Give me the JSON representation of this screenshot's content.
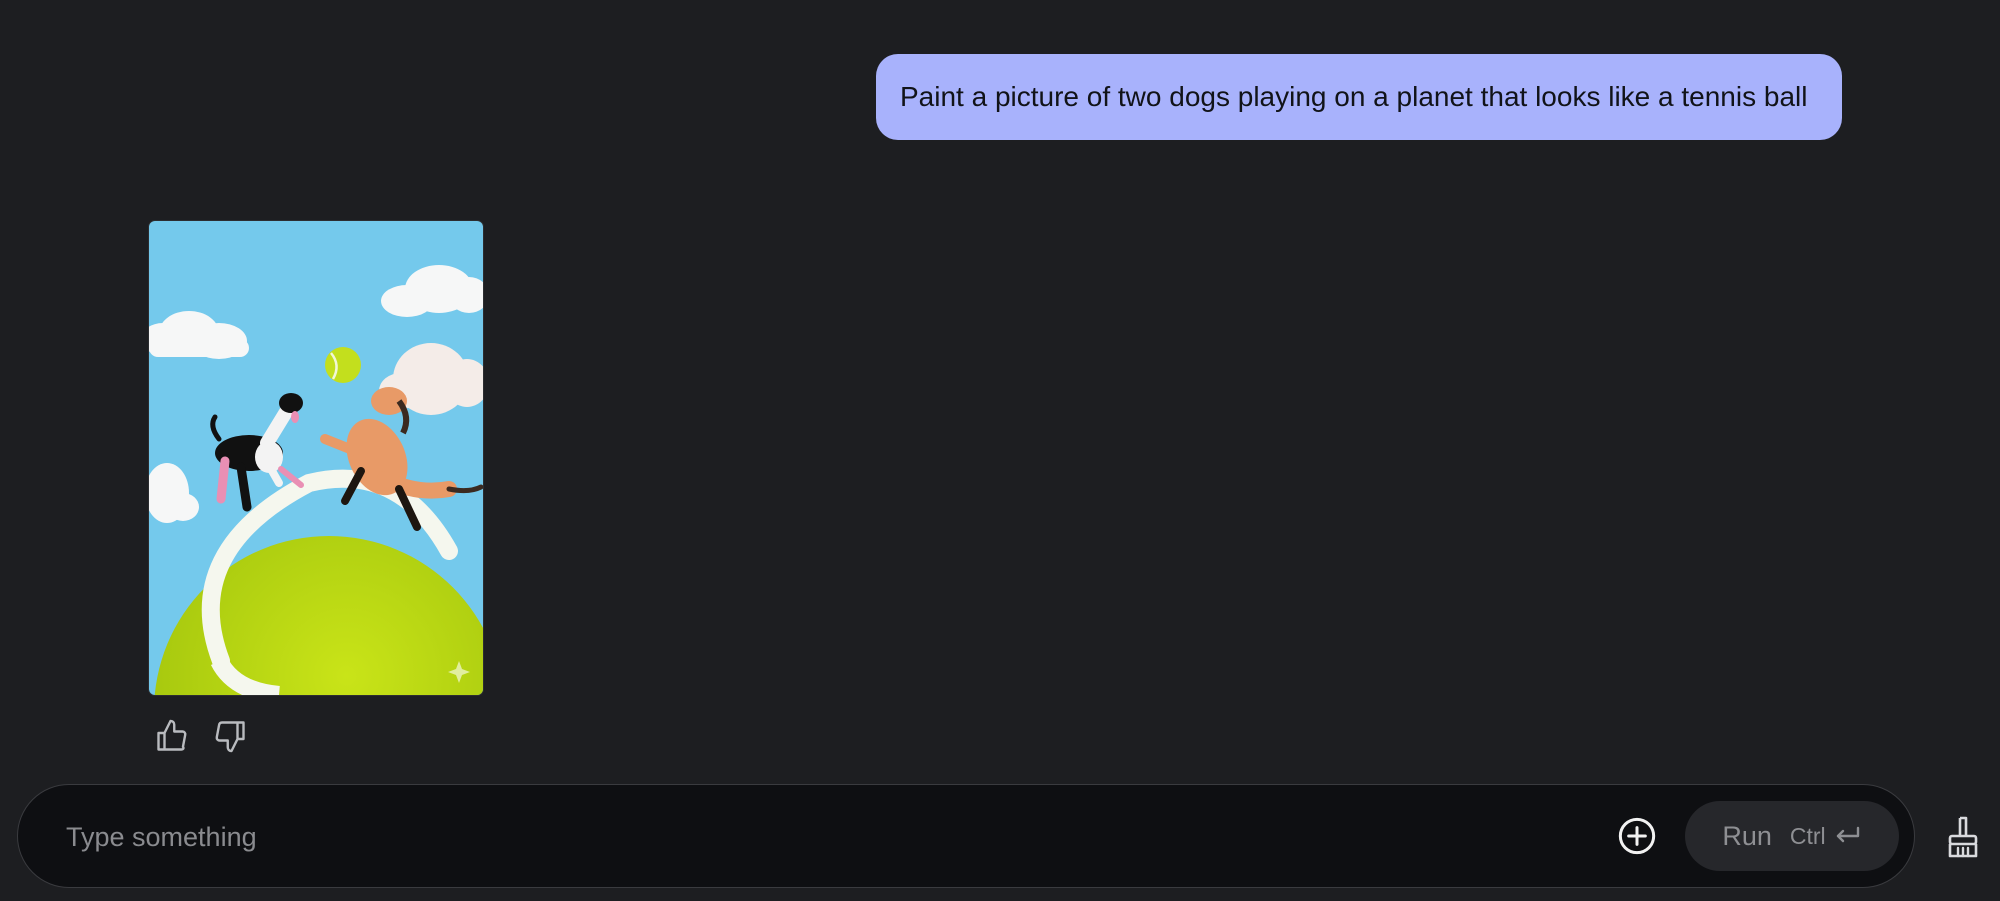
{
  "conversation": {
    "user_message": "Paint a picture of two dogs playing on a planet that looks like a tennis ball",
    "generated_image": {
      "subject": "two dogs playing on a tennis ball planet"
    },
    "feedback": {
      "like_icon": "thumb-up-icon",
      "dislike_icon": "thumb-down-icon"
    }
  },
  "composer": {
    "placeholder": "Type something",
    "value": "",
    "add_icon": "add-circle-icon",
    "run_label": "Run",
    "shortcut_label": "Ctrl",
    "shortcut_icon": "enter-key-icon",
    "clear_icon": "broom-icon"
  },
  "colors": {
    "background": "#1d1e21",
    "user_bubble": "#a8b2fc",
    "input_bg": "#0e0f12",
    "run_bg": "#26272b",
    "muted_text": "#8e8f93"
  }
}
